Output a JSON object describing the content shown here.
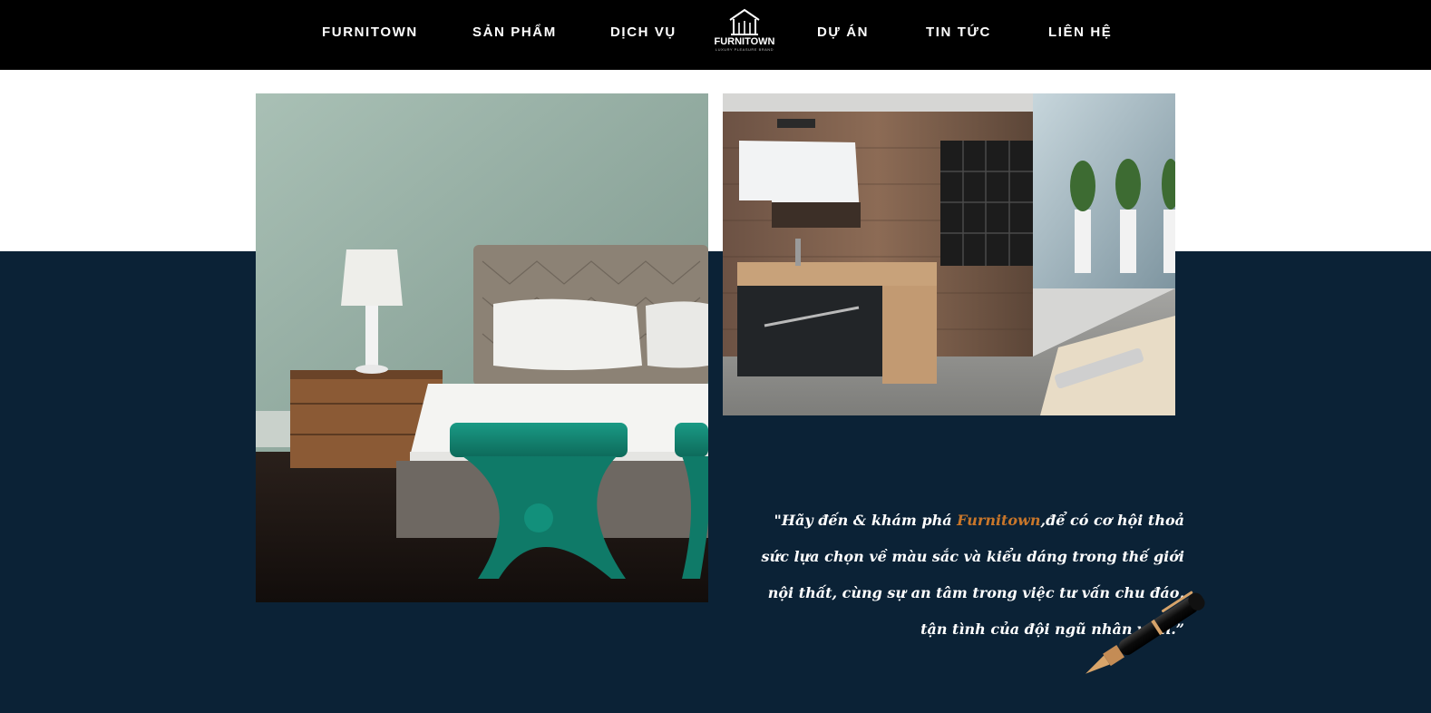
{
  "nav": {
    "items": [
      {
        "label": "FURNITOWN"
      },
      {
        "label": "SẢN PHẨM"
      },
      {
        "label": "DỊCH VỤ"
      },
      {
        "label": "DỰ ÁN"
      },
      {
        "label": "TIN TỨC"
      },
      {
        "label": "LIÊN HỆ"
      }
    ],
    "logo": {
      "name": "FURNITOWN",
      "tagline": "luxury pleasure brand",
      "icon": "house-outline-icon"
    }
  },
  "gallery": {
    "images": [
      {
        "subject": "bedroom-photo"
      },
      {
        "subject": "bathroom-photo"
      }
    ]
  },
  "quote": {
    "open": "\"Hãy đến & khám phá ",
    "brand": "Furnitown",
    "rest": ",để có cơ hội thoả",
    "line2": "sức lựa chọn về màu sắc và kiểu dáng trong thế giới",
    "line3": "nội thất, cùng sự an tâm trong việc tư vấn chu đáo,",
    "line4": "tận tình của đội ngũ nhân viên.”"
  },
  "decor": {
    "icon": "fountain-pen-icon"
  },
  "colors": {
    "nav_bg": "#000000",
    "band_bg": "#0b2236",
    "accent": "#c8762a",
    "text_light": "#ffffff"
  }
}
